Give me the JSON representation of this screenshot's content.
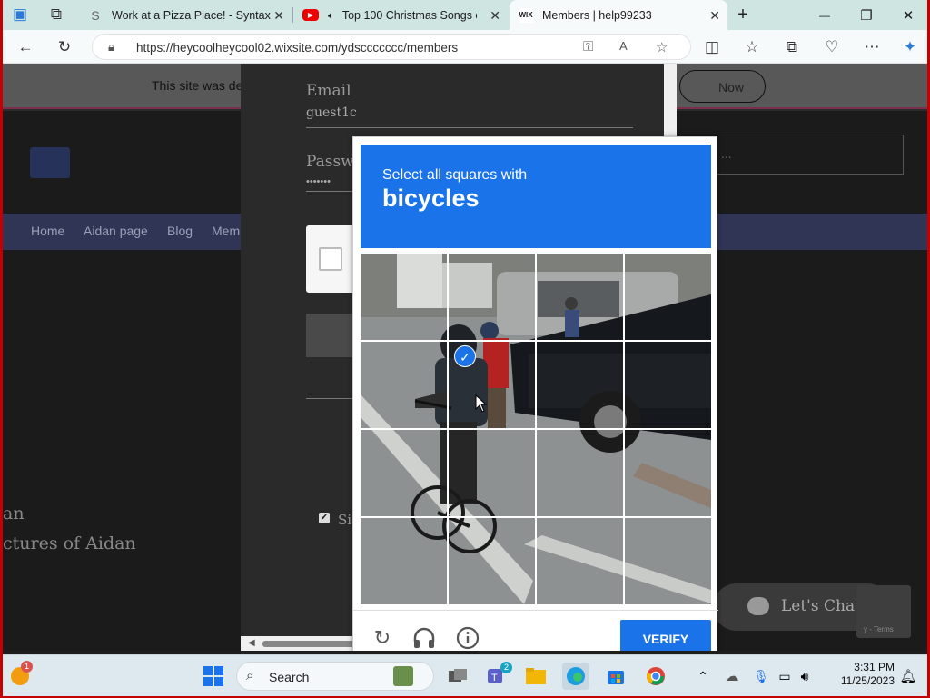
{
  "tabs": [
    {
      "title": "Work at a Pizza Place! - Syntax",
      "close": "✕"
    },
    {
      "title": "Top 100 Christmas Songs of",
      "close": "✕"
    },
    {
      "title": "Members | help99233",
      "close": "✕"
    }
  ],
  "window_controls": {
    "new_tab": "+",
    "minimize": "—",
    "maximize": "❐",
    "close": "✕"
  },
  "address": {
    "url": "https://heycoolheycool02.wixsite.com/ydsccccccc/members"
  },
  "banner": {
    "text": "This site was de",
    "button": "Now"
  },
  "site": {
    "nav": [
      "Home",
      "Aidan page",
      "Blog",
      "Mem"
    ],
    "search_text": "...",
    "left_text_1": "an",
    "left_text_2": "ctures of Aidan"
  },
  "login": {
    "email_label": "Email",
    "email_value": "guest1c",
    "password_label": "Passw",
    "password_value": "•••••••",
    "sign_label": "Sig"
  },
  "captcha": {
    "instruction": "Select all squares with",
    "target": "bicycles",
    "verify": "VERIFY",
    "selected_tiles": [
      5
    ]
  },
  "chat": {
    "label": "Let's Chat!"
  },
  "recaptcha_badge": "y - Terms",
  "taskbar": {
    "search": "Search",
    "time": "3:31 PM",
    "date": "11/25/2023",
    "teams_badge": "2",
    "weather_badge": "1"
  }
}
